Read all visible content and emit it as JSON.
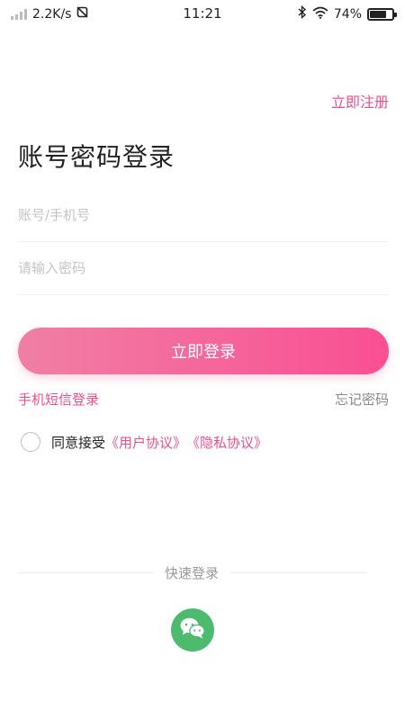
{
  "status_bar": {
    "net_speed": "2.2K/s",
    "time": "11:21",
    "battery_percent": "74%",
    "battery_level": 0.74
  },
  "header": {
    "register_label": "立即注册"
  },
  "title": "账号密码登录",
  "form": {
    "account_placeholder": "账号/手机号",
    "account_value": "",
    "password_placeholder": "请输入密码",
    "password_value": "",
    "login_label": "立即登录"
  },
  "links": {
    "sms_login": "手机短信登录",
    "forgot_password": "忘记密码"
  },
  "agreement": {
    "checked": false,
    "prefix": "同意接受",
    "user_agreement": "《用户协议》",
    "privacy_policy": "《隐私协议》"
  },
  "quick_login": {
    "label": "快速登录",
    "icon": "wechat-icon"
  },
  "colors": {
    "accent": "#ee4e8f",
    "gradient_start": "#f07fa4",
    "gradient_end": "#fa4f93",
    "wechat": "#4cbb6d"
  }
}
